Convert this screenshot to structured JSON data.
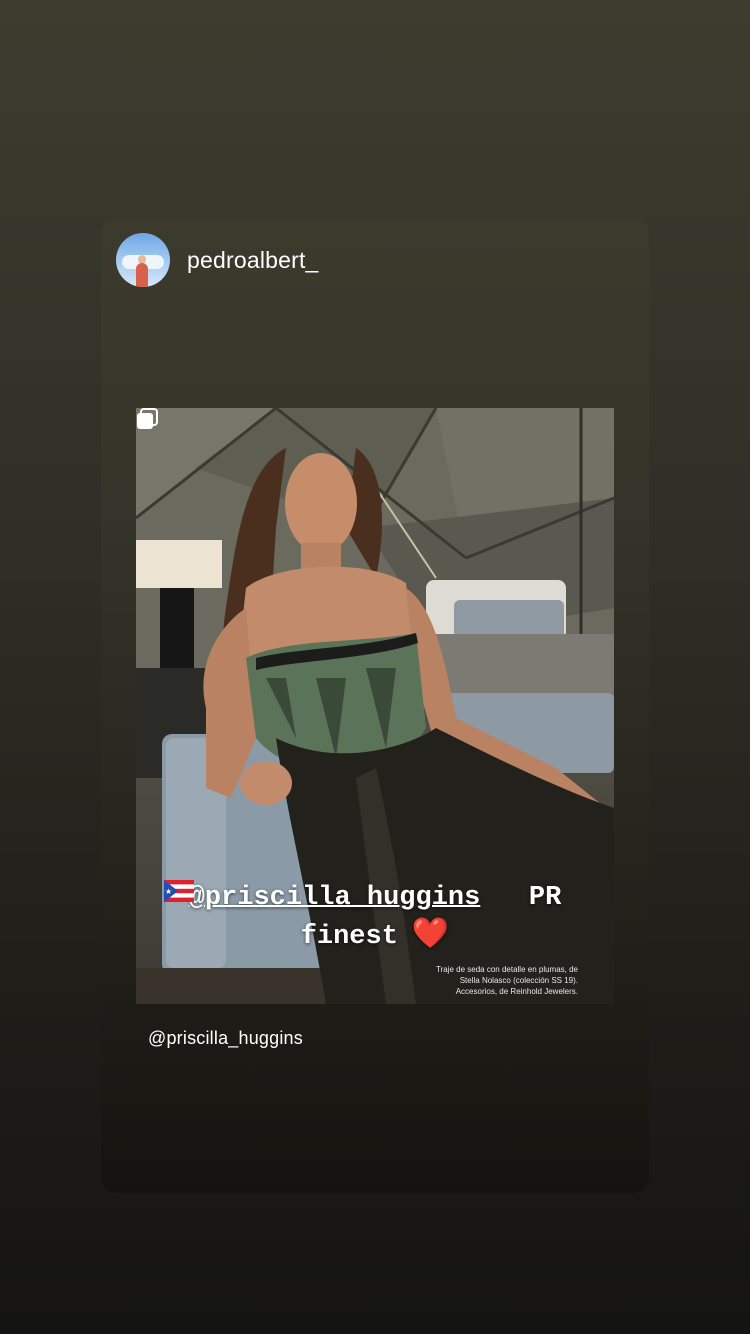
{
  "story": {
    "author": {
      "username": "pedroalbert_",
      "avatar_icon": "profile-avatar"
    },
    "shared_post": {
      "image_alt": "",
      "multi_image_icon": "carousel-icon",
      "print_caption": "Traje de seda con detalle en plumas, de Stella Nolasco (colección SS 19). Accesorios, de Reinhold Jewelers."
    },
    "sticker": {
      "mention": "@priscilla_huggins",
      "text_after_mention": "PR",
      "line2": "finest",
      "heart_emoji": "❤️",
      "flag_icon": "puerto-rico-flag-icon"
    },
    "mention_tag": "@priscilla_huggins"
  },
  "colors": {
    "background_top": "#3d3c2f",
    "background_bottom": "#141413",
    "text": "#ffffff",
    "heart": "#e0202e"
  }
}
